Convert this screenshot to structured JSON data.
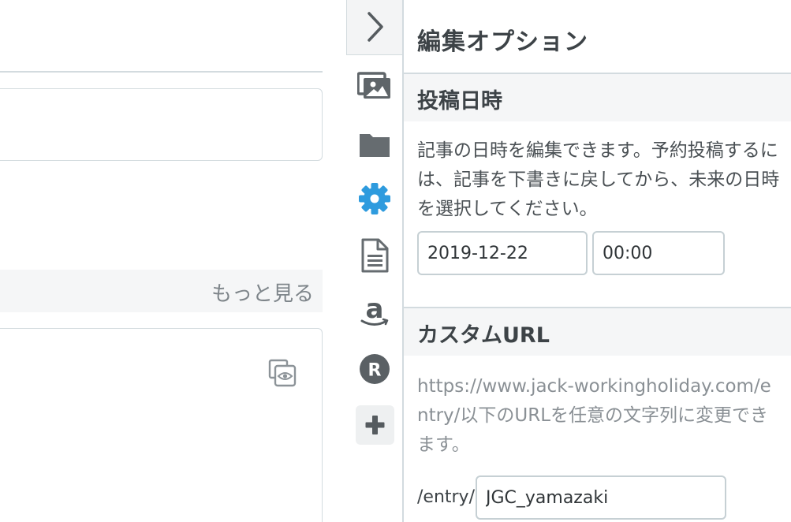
{
  "editor": {
    "more_label": "もっと見る",
    "icons": {
      "preview": "preview-copy-eye-icon"
    }
  },
  "toolbar": {
    "icons": [
      "chevron-right-icon",
      "image-icon",
      "folder-icon",
      "gear-icon",
      "document-icon",
      "amazon-icon",
      "rakuten-icon",
      "plus-icon"
    ],
    "active_color": "#2e9bde",
    "icon_color": "#666c70"
  },
  "panel": {
    "title": "編集オプション",
    "post_date": {
      "heading": "投稿日時",
      "description": "記事の日時を編集できます。予約投稿するには、記事を下書きに戻してから、未来の日時を選択してください。",
      "date_value": "2019-12-22",
      "time_value": "00:00"
    },
    "custom_url": {
      "heading": "カスタムURL",
      "description": "https://www.jack-workingholiday.com/entry/以下のURLを任意の文字列に変更できます。",
      "prefix": "/entry/",
      "slug_value": "JGC_yamazaki"
    }
  }
}
